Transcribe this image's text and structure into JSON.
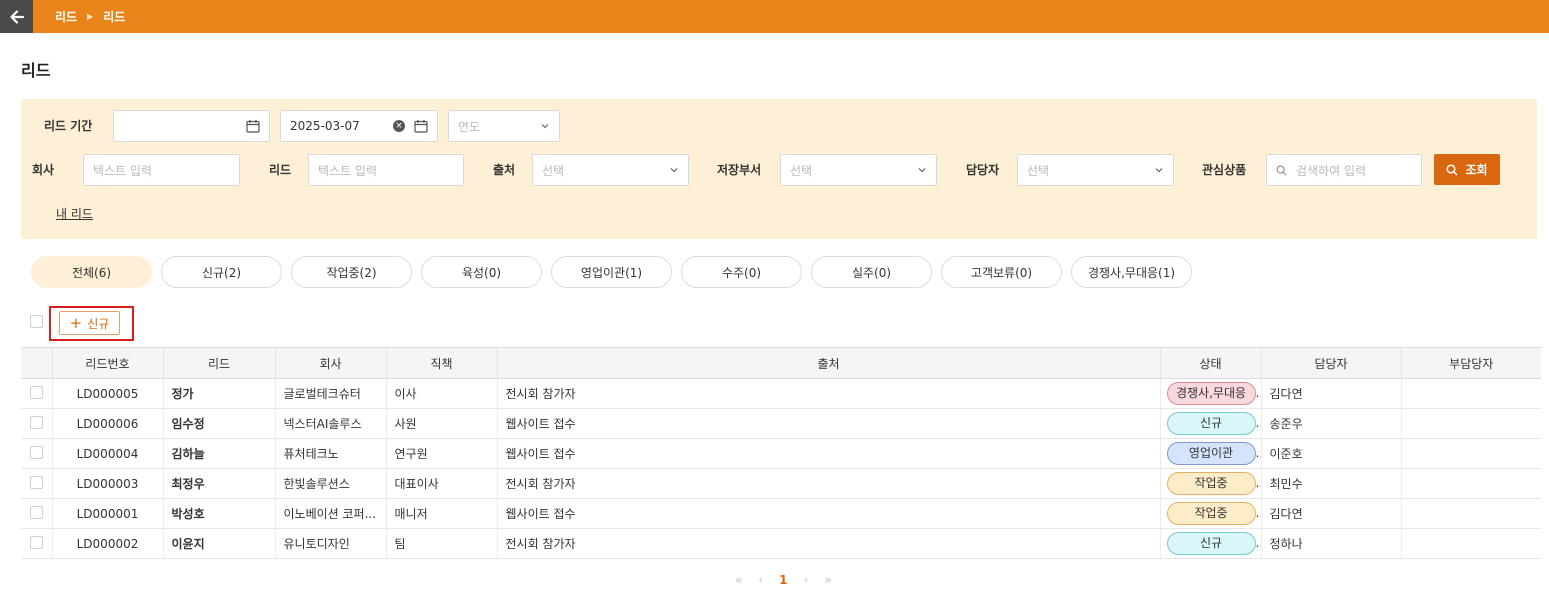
{
  "breadcrumb": [
    "리드",
    "리드"
  ],
  "page_title": "리드",
  "filters": {
    "period_label": "리드 기간",
    "date_start": "",
    "date_end": "2025-03-07",
    "year_placeholder": "연도",
    "company_label": "회사",
    "company_placeholder": "텍스트 입력",
    "lead_label": "리드",
    "lead_placeholder": "텍스트 입력",
    "source_label": "출처",
    "source_placeholder": "선택",
    "dept_label": "저장부서",
    "dept_placeholder": "선택",
    "owner_label": "담당자",
    "owner_placeholder": "선택",
    "product_label": "관심상품",
    "product_placeholder": "검색하여 입력",
    "search_label": "조회",
    "my_leads": "내 리드"
  },
  "tabs": [
    {
      "label": "전체(6)",
      "active": true
    },
    {
      "label": "신규(2)",
      "active": false
    },
    {
      "label": "작업중(2)",
      "active": false
    },
    {
      "label": "육성(0)",
      "active": false
    },
    {
      "label": "영업이관(1)",
      "active": false
    },
    {
      "label": "수주(0)",
      "active": false
    },
    {
      "label": "실주(0)",
      "active": false
    },
    {
      "label": "고객보류(0)",
      "active": false
    },
    {
      "label": "경쟁사,무대응(1)",
      "active": false
    }
  ],
  "toolbar": {
    "new_label": "신규"
  },
  "table": {
    "columns": [
      "리드번호",
      "리드",
      "회사",
      "직책",
      "출처",
      "상태",
      "담당자",
      "부담당자"
    ],
    "rows": [
      {
        "id": "LD000005",
        "name": "정가",
        "company": "글로벌테크슈터",
        "title": "이사",
        "source": "전시회 참가자",
        "status": "경쟁사,무대응",
        "status_color": "red",
        "owner": "김다연",
        "sub_owner": ""
      },
      {
        "id": "LD000006",
        "name": "임수정",
        "company": "넥스터AI솔루스",
        "title": "사원",
        "source": "웹사이트 접수",
        "status": "신규",
        "status_color": "cyan",
        "owner": "송준우",
        "sub_owner": ""
      },
      {
        "id": "LD000004",
        "name": "김하늘",
        "company": "퓨처테크노",
        "title": "연구원",
        "source": "웹사이트 접수",
        "status": "영업이관",
        "status_color": "blue",
        "owner": "이준호",
        "sub_owner": ""
      },
      {
        "id": "LD000003",
        "name": "최정우",
        "company": "한빛솔루션스",
        "title": "대표이사",
        "source": "전시회 참가자",
        "status": "작업중",
        "status_color": "yellow",
        "owner": "최민수",
        "sub_owner": ""
      },
      {
        "id": "LD000001",
        "name": "박성호",
        "company": "이노베이션 코퍼...",
        "title": "매니저",
        "source": "웹사이트 접수",
        "status": "작업중",
        "status_color": "yellow",
        "owner": "김다연",
        "sub_owner": ""
      },
      {
        "id": "LD000002",
        "name": "이윤지",
        "company": "유니토디자인",
        "title": "팀",
        "source": "전시회 참가자",
        "status": "신규",
        "status_color": "cyan",
        "owner": "정하나",
        "sub_owner": ""
      }
    ]
  },
  "pagination": {
    "first": "«",
    "prev": "‹",
    "current": "1",
    "next": "›",
    "last": "»"
  }
}
